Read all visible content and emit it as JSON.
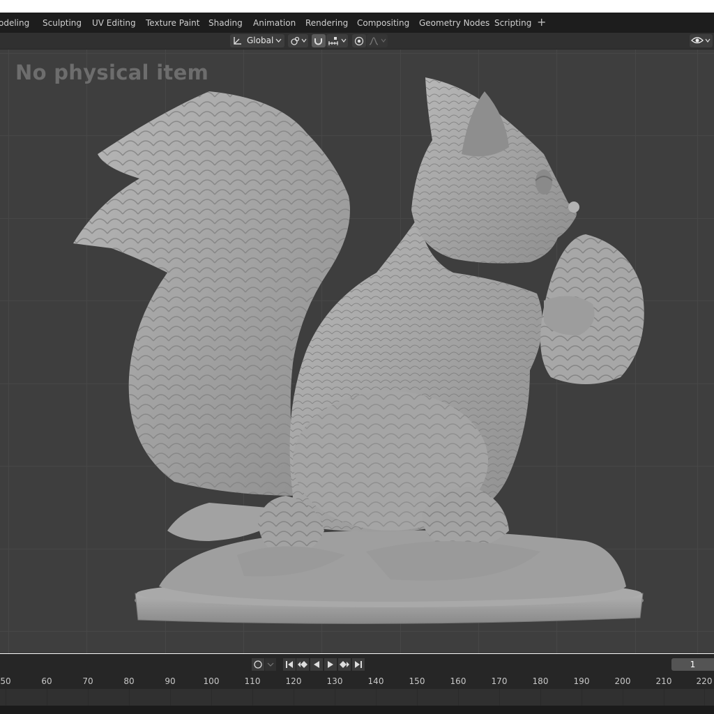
{
  "workspace_tabs": [
    "odeling",
    "Sculpting",
    "UV Editing",
    "Texture Paint",
    "Shading",
    "Animation",
    "Rendering",
    "Compositing",
    "Geometry Nodes",
    "Scripting"
  ],
  "add_tab_label": "+",
  "header": {
    "transform_orientation": "Global"
  },
  "viewport": {
    "overlay_text": "No physical item",
    "grid": "on"
  },
  "timeline": {
    "current_frame": "1",
    "ruler_ticks": [
      "50",
      "60",
      "70",
      "80",
      "90",
      "100",
      "110",
      "120",
      "130",
      "140",
      "150",
      "160",
      "170",
      "180",
      "190",
      "200",
      "210",
      "220"
    ]
  },
  "colors": {
    "viewport_bg": "#3e3e3e",
    "model": "#a8a8a8",
    "overlay_text": "#6d6d6d"
  }
}
